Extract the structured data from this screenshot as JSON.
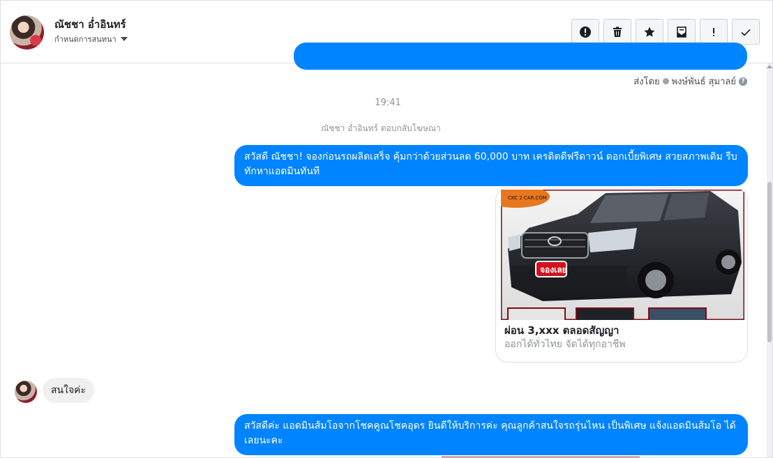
{
  "header": {
    "contact_name": "ณัชชา อ่ำอินทร์",
    "contact_sub": "กำหนดการสนทนา",
    "toolbar": [
      {
        "icon": "report-icon",
        "label": "!"
      },
      {
        "icon": "trash-icon"
      },
      {
        "icon": "star-icon"
      },
      {
        "icon": "mark-unread-icon"
      },
      {
        "icon": "important-icon",
        "label": "!"
      },
      {
        "icon": "done-check-icon"
      }
    ]
  },
  "conversation": {
    "sent_by_prefix": "ส่งโดย",
    "sent_by_name": "พงษ์พันธ์ สุมาลย์",
    "timestamp": "19:41",
    "replied_to_ad": "ณัชชา อ่ำอินทร์ ตอบกลับโฆษณา",
    "outgoing_message_1": "สวัสดี ณัชชา! จองก่อนรถผลิตเสร็จ คุ้มกว่าด้วยส่วนลด 60,000 บาท เครดิตดีฟรีดาวน์ ดอกเบี้ยพิเศษ สวยสภาพเดิม รีบทักหาแอดมินทันที",
    "ad_card": {
      "title": "ผ่อน 3,xxx ตลอดสัญญา",
      "description": "ออกได้ทั่วไทย จัดได้ทุกอาชีพ",
      "image_badge": "จองเลย",
      "image_logo": "CKC 2 CAR.COM"
    },
    "incoming_message": "สนใจค่ะ",
    "outgoing_message_2": "สวัสดีค่ะ แอดมินส้มโอจากโชคคูณโชคอุดร ยินดีให้บริการค่ะ   คุณลูกค้าสนใจรถรุ่นไหน เป็นพิเศษ แจ้งแอดมินส้มโอ ได้เลยนะคะ"
  },
  "colors": {
    "accent": "#0084ff",
    "incoming_bg": "#f1f0f0",
    "muted_text": "#90949c"
  }
}
